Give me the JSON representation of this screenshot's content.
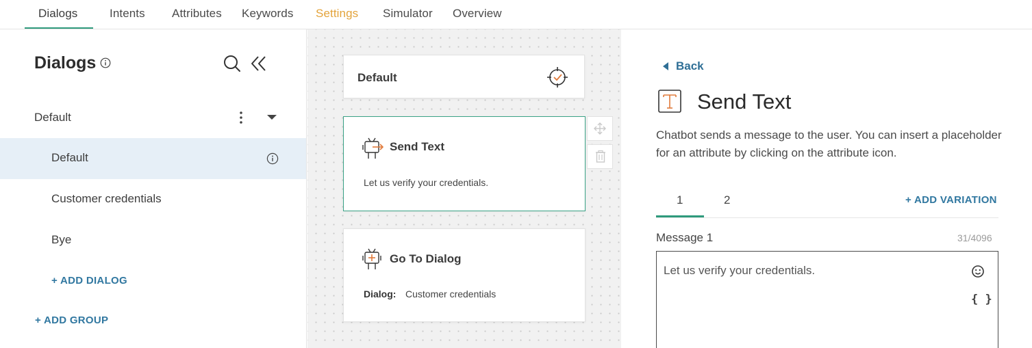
{
  "nav": {
    "tabs": [
      {
        "label": "Dialogs"
      },
      {
        "label": "Intents"
      },
      {
        "label": "Attributes"
      },
      {
        "label": "Keywords"
      },
      {
        "label": "Settings"
      },
      {
        "label": "Simulator"
      },
      {
        "label": "Overview"
      }
    ],
    "active_tab": "Dialogs"
  },
  "sidebar": {
    "title": "Dialogs",
    "group": {
      "label": "Default"
    },
    "dialogs": [
      {
        "label": "Default",
        "selected": true
      },
      {
        "label": "Customer credentials"
      },
      {
        "label": "Bye"
      }
    ],
    "add_dialog": "+ ADD DIALOG",
    "add_group": "+ ADD GROUP"
  },
  "canvas": {
    "default_card": {
      "title": "Default"
    },
    "send_text_card": {
      "title": "Send Text",
      "text": "Let us verify your credentials."
    },
    "go_to_dialog_card": {
      "title": "Go To Dialog",
      "dialog_label": "Dialog:",
      "dialog_value": "Customer credentials"
    }
  },
  "panel": {
    "back": "Back",
    "title": "Send Text",
    "description": "Chatbot sends a message to the user. You can insert a placeholder for an attribute by clicking on the attribute icon.",
    "variation_tabs": [
      {
        "label": "1"
      },
      {
        "label": "2"
      }
    ],
    "add_variation": "+ ADD VARIATION",
    "message_label": "Message 1",
    "message_count": "31/4096",
    "message_text": "Let us verify your credentials.",
    "braces": "{ }"
  },
  "colors": {
    "accent_green": "#2e9a7c",
    "link_blue": "#3077a0",
    "settings_orange": "#e3a33a",
    "selected_bg": "#e6eff7",
    "icon_orange": "#e07a3a"
  }
}
